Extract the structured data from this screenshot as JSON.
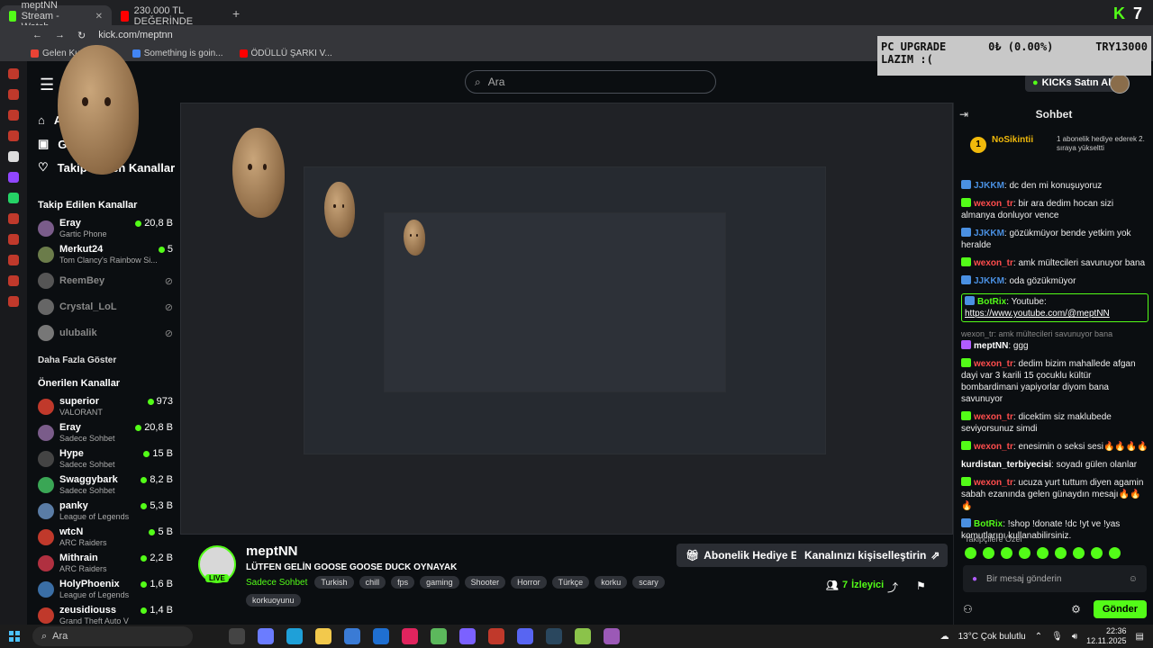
{
  "browser": {
    "tabs": [
      {
        "label": "meptNN Stream - Watch",
        "active": true,
        "color": "#53fc18"
      },
      {
        "label": "230.000 TL DEĞERİNDE",
        "active": false,
        "color": "#ff0000"
      }
    ],
    "url": "kick.com/meptnn",
    "bookmarks": [
      {
        "label": "Gelen Ku",
        "color": "#ea4335"
      },
      {
        "label": "Something is goin...",
        "color": "#4285f4"
      },
      {
        "label": "ÖDÜLLÜ ŞARKI V...",
        "color": "#ff0000"
      }
    ]
  },
  "header": {
    "search_placeholder": "Ara",
    "kicks_button": "KICKs Satın Al",
    "logo_number": "7"
  },
  "overlay": {
    "title_line1": "PC UPGRADE",
    "title_line2": "LAZIM :(",
    "progress": "0₺ (0.00%)",
    "goal": "TRY13000"
  },
  "sidebar": {
    "nav": [
      {
        "label": "A",
        "icon": "home-icon"
      },
      {
        "label": "G",
        "icon": "browse-icon"
      },
      {
        "label": "Takip Edilen Kanallar",
        "icon": "heart-icon"
      }
    ],
    "followed_title": "Takip Edilen Kanallar",
    "followed": [
      {
        "name": "Eray",
        "sub": "Gartic Phone",
        "viewers": "20,8 B",
        "online": true,
        "color": "#7a5c8a"
      },
      {
        "name": "Merkut24",
        "sub": "Tom Clancy's Rainbow Si...",
        "viewers": "5",
        "online": true,
        "color": "#6b7c4a"
      },
      {
        "name": "ReemBey",
        "sub": "",
        "viewers": "",
        "online": false,
        "color": "#555"
      },
      {
        "name": "Crystal_LoL",
        "sub": "",
        "viewers": "",
        "online": false,
        "color": "#666"
      },
      {
        "name": "ulubalik",
        "sub": "",
        "viewers": "",
        "online": false,
        "color": "#777"
      }
    ],
    "show_more": "Daha Fazla Göster",
    "recommended_title": "Önerilen Kanallar",
    "recommended": [
      {
        "name": "superior",
        "sub": "VALORANT",
        "viewers": "973",
        "color": "#c0392b"
      },
      {
        "name": "Eray",
        "sub": "Sadece Sohbet",
        "viewers": "20,8 B",
        "color": "#7a5c8a"
      },
      {
        "name": "Hype",
        "sub": "Sadece Sohbet",
        "viewers": "15 B",
        "color": "#333"
      },
      {
        "name": "Swaggybark",
        "sub": "Sadece Sohbet",
        "viewers": "8,2 B",
        "color": "#3aa655"
      },
      {
        "name": "panky",
        "sub": "League of Legends",
        "viewers": "5,3 B",
        "color": "#5a7ca5"
      },
      {
        "name": "wtcN",
        "sub": "ARC Raiders",
        "viewers": "5 B",
        "color": "#c0392b"
      },
      {
        "name": "Mithrain",
        "sub": "ARC Raiders",
        "viewers": "2,2 B",
        "color": "#b03040"
      },
      {
        "name": "HolyPhoenix",
        "sub": "League of Legends",
        "viewers": "1,6 B",
        "color": "#3a6ea5"
      },
      {
        "name": "zeusidiouss",
        "sub": "Grand Theft Auto V",
        "viewers": "1,4 B",
        "color": "#c0392b"
      }
    ]
  },
  "stream": {
    "streamer": "meptNN",
    "title": "LÜTFEN GELİN GOOSE GOOSE DUCK OYNAYAK",
    "category": "Sadece Sohbet",
    "tags": [
      "Turkish",
      "chill",
      "fps",
      "gaming",
      "Shooter",
      "Horror",
      "Türkçe",
      "korku",
      "scary",
      "korkuoyunu"
    ],
    "live_badge": "LIVE",
    "gift_button": "Abonelik Hediye Et",
    "customize_button": "Kanalınızı kişiselleştirin",
    "viewers_count": "7",
    "viewers_label": "İzleyici"
  },
  "chat": {
    "title": "Sohbet",
    "pinned": {
      "badge": "1",
      "name": "NoSikintii",
      "text": "1 abonelik hediye ederek 2. sıraya yükseltti"
    },
    "messages": [
      {
        "user": "JJKKM",
        "user_color": "#4a90e2",
        "text": ": dc den mi konuşuyoruz",
        "icon_color": "#4a90e2"
      },
      {
        "user": "wexon_tr",
        "user_color": "#ff4d4d",
        "text": ": bir ara dedim hocan sizi almanya donluyor vence",
        "icon_color": "#53fc18"
      },
      {
        "user": "JJKKM",
        "user_color": "#4a90e2",
        "text": ": gözükmüyor bende yetkim yok heralde",
        "icon_color": "#4a90e2"
      },
      {
        "user": "wexon_tr",
        "user_color": "#ff4d4d",
        "text": ": amk mültecileri savunuyor bana",
        "icon_color": "#53fc18"
      },
      {
        "user": "JJKKM",
        "user_color": "#4a90e2",
        "text": ": oda gözükmüyor",
        "icon_color": "#4a90e2"
      }
    ],
    "highlight": {
      "user": "BotRix",
      "text": ": Youtube:",
      "link": "https://www.youtube.com/@meptNN"
    },
    "reply_text": "wexon_tr: amk mültecileri savunuyor bana",
    "messages2": [
      {
        "user": "meptNN",
        "user_color": "#ffffff",
        "text": ": ggg",
        "icon_color": "#b15cff"
      },
      {
        "user": "wexon_tr",
        "user_color": "#ff4d4d",
        "text": ": dedim bizim mahallede afgan dayi var 3 karili 15 çocuklu kültür bombardimani yapiyorlar diyom bana savunuyor",
        "icon_color": "#53fc18"
      },
      {
        "user": "wexon_tr",
        "user_color": "#ff4d4d",
        "text": ": dicektim siz maklubede seviyorsunuz simdi",
        "icon_color": "#53fc18"
      },
      {
        "user": "wexon_tr",
        "user_color": "#ff4d4d",
        "text": ": enesimin o seksi sesi🔥🔥🔥🔥",
        "icon_color": "#53fc18"
      },
      {
        "user": "kurdistan_terbiyecisi",
        "user_color": "#ffffff",
        "text": ": soyadı gülen olanlar",
        "icon_color": ""
      },
      {
        "user": "wexon_tr",
        "user_color": "#ff4d4d",
        "text": ": ucuza yurt tuttum diyen agamin sabah ezanında gelen günaydın mesajı🔥🔥🔥",
        "icon_color": "#53fc18"
      },
      {
        "user": "BotRix",
        "user_color": "#53fc18",
        "text": ": !shop !donate !dc !yt ve !yas komutlarını kullanabilirsiniz.",
        "icon_color": "#4a90e2"
      }
    ],
    "follow_label": "Takipçilere Özel",
    "input_placeholder": "Bir mesaj gönderin",
    "send_button": "Gönder"
  },
  "taskbar": {
    "search_placeholder": "Ara",
    "weather": "13°C  Çok bulutlu",
    "time": "22:36",
    "date": "12.11.2025"
  }
}
